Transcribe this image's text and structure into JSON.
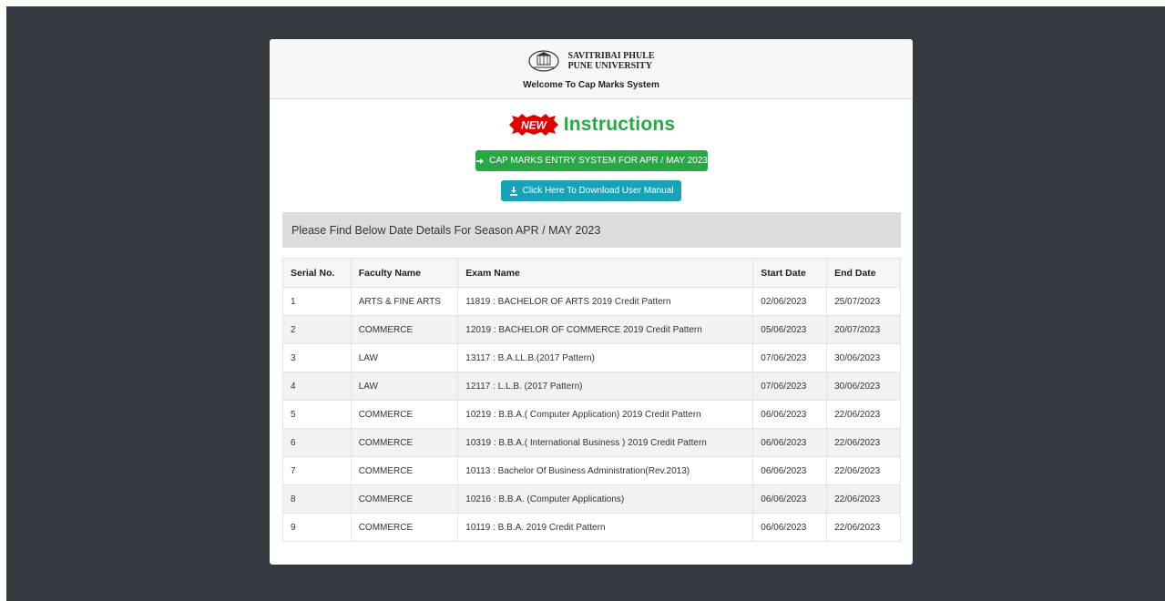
{
  "header": {
    "university_line1": "SAVITRIBAI PHULE",
    "university_line2": "PUNE UNIVERSITY",
    "welcome": "Welcome To Cap Marks System",
    "logo_icon": "university-seal-icon"
  },
  "instructions": {
    "badge_text": "NEW",
    "title": "Instructions",
    "title_color": "#28a745"
  },
  "buttons": {
    "cap_entry_label": "CAP MARKS ENTRY SYSTEM FOR APR / MAY 2023",
    "cap_entry_icon": "sign-in-icon",
    "download_manual_label": "Click Here To Download User Manual",
    "download_manual_icon": "download-icon"
  },
  "season_heading": "Please Find Below Date Details For Season APR / MAY 2023",
  "table": {
    "columns": [
      "Serial No.",
      "Faculty Name",
      "Exam Name",
      "Start Date",
      "End Date"
    ],
    "rows": [
      [
        "1",
        "ARTS & FINE ARTS",
        "11819 : BACHELOR OF ARTS 2019 Credit Pattern",
        "02/06/2023",
        "25/07/2023"
      ],
      [
        "2",
        "COMMERCE",
        "12019 : BACHELOR OF COMMERCE 2019 Credit Pattern",
        "05/06/2023",
        "20/07/2023"
      ],
      [
        "3",
        "LAW",
        "13117 : B.A.LL.B.(2017 Pattern)",
        "07/06/2023",
        "30/06/2023"
      ],
      [
        "4",
        "LAW",
        "12117 : L.L.B. (2017 Pattern)",
        "07/06/2023",
        "30/06/2023"
      ],
      [
        "5",
        "COMMERCE",
        "10219 : B.B.A.( Computer Application) 2019 Credit Pattern",
        "06/06/2023",
        "22/06/2023"
      ],
      [
        "6",
        "COMMERCE",
        "10319 : B.B.A.( International Business ) 2019 Credit Pattern",
        "06/06/2023",
        "22/06/2023"
      ],
      [
        "7",
        "COMMERCE",
        "10113 : Bachelor Of Business Administration(Rev.2013)",
        "06/06/2023",
        "22/06/2023"
      ],
      [
        "8",
        "COMMERCE",
        "10216 : B.B.A. (Computer Applications)",
        "06/06/2023",
        "22/06/2023"
      ],
      [
        "9",
        "COMMERCE",
        "10119 : B.B.A. 2019 Credit Pattern",
        "06/06/2023",
        "22/06/2023"
      ]
    ]
  },
  "colors": {
    "background": "#343a40",
    "green_button": "#28a745",
    "teal_button": "#17a2b8",
    "badge_red": "#e00000"
  }
}
